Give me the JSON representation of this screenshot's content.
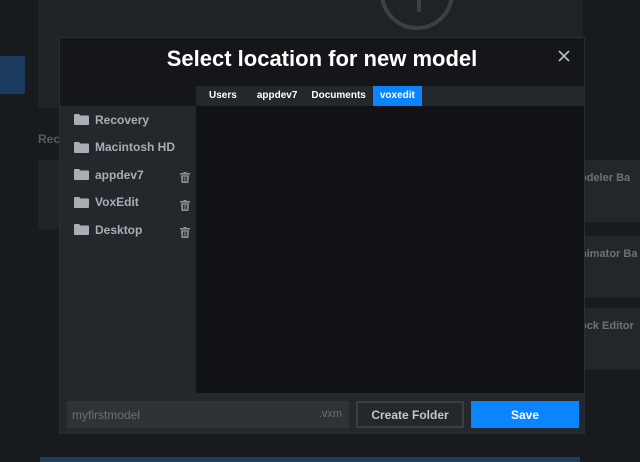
{
  "background": {
    "recent_label": "Rec",
    "cards": [
      "odeler Ba",
      "nimator Ba",
      "ock Editor"
    ]
  },
  "dialog": {
    "title": "Select location for new model",
    "close_icon": "close-icon"
  },
  "breadcrumbs": [
    {
      "label": "Users",
      "active": false
    },
    {
      "label": "appdev7",
      "active": false
    },
    {
      "label": "Documents",
      "active": false
    },
    {
      "label": "voxedit",
      "active": true
    }
  ],
  "sidebar": {
    "items": [
      {
        "label": "Recovery",
        "icon": "folder-icon",
        "trash": false
      },
      {
        "label": "Macintosh HD",
        "icon": "folder-icon",
        "trash": false
      },
      {
        "label": "appdev7",
        "icon": "folder-icon",
        "trash": true
      },
      {
        "label": "VoxEdit",
        "icon": "folder-icon",
        "trash": true
      },
      {
        "label": "Desktop",
        "icon": "folder-icon",
        "trash": true
      }
    ]
  },
  "footer": {
    "filename_value": "myfirstmodel",
    "extension": ".vxm",
    "create_folder_label": "Create Folder",
    "save_label": "Save"
  },
  "colors": {
    "accent": "#0a84ff",
    "panel": "#23282d",
    "dialog_bg": "#141619"
  }
}
